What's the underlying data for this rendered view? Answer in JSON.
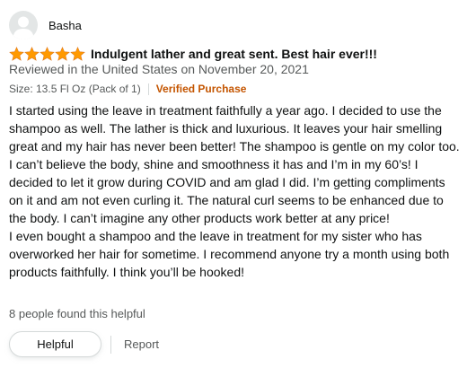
{
  "reviewer": {
    "name": "Basha",
    "avatar_icon": "default-profile-avatar"
  },
  "rating": {
    "stars": 5,
    "max": 5,
    "star_color": "#ff9900"
  },
  "review": {
    "title": "Indulgent lather and great sent. Best hair ever!!!",
    "date_line": "Reviewed in the United States on November 20, 2021",
    "format": "Size: 13.5 Fl Oz (Pack of 1)",
    "verified_label": "Verified Purchase",
    "body": [
      "I started using the leave in treatment faithfully a year ago. I decided to use the shampoo as well. The lather is thick and luxurious. It leaves your hair smelling great and my hair has never been better! The shampoo is gentle on my color too. I can’t believe the body, shine and smoothness it has and I’m in my 60’s! I decided to let it grow during COVID and am glad I did. I’m getting compliments on it and am not even curling it. The natural curl seems to be enhanced due to the body. I can’t imagine any other products work better at any price!",
      "I even bought a shampoo and the leave in treatment for my sister who has overworked her hair for sometime. I recommend anyone try a month using both products faithfully. I think you’ll be hooked!"
    ]
  },
  "helpful": {
    "count_text": "8 people found this helpful",
    "helpful_button": "Helpful",
    "report_link": "Report"
  },
  "colors": {
    "verified": "#c45500",
    "secondary_text": "#565959",
    "primary_text": "#0f1111"
  }
}
